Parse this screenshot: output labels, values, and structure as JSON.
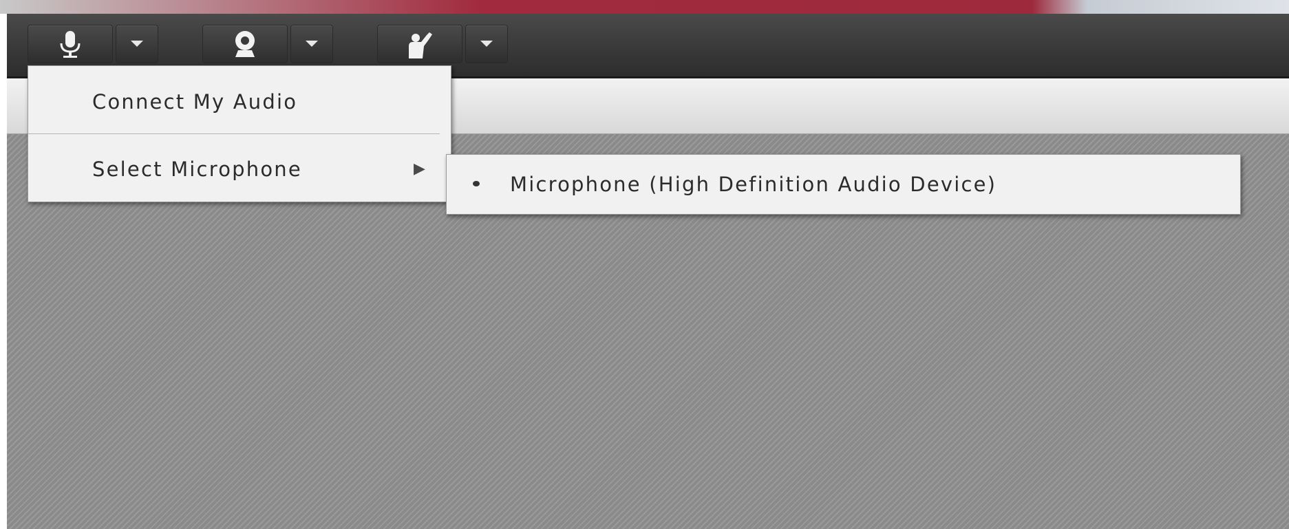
{
  "toolbar": {
    "buttons": [
      {
        "name": "microphone",
        "icon": "microphone-icon"
      },
      {
        "name": "webcam",
        "icon": "webcam-icon"
      },
      {
        "name": "raise-hand",
        "icon": "raise-hand-icon"
      }
    ]
  },
  "audio_menu": {
    "connect_label": "Connect My Audio",
    "select_mic_label": "Select Microphone",
    "submenu_arrow": "▶"
  },
  "microphone_submenu": {
    "items": [
      {
        "label": "Microphone (High Definition Audio Device)",
        "selected": true
      }
    ]
  },
  "colors": {
    "toolbar_bg": "#3a3a3a",
    "menu_bg": "#f1f1f1",
    "stage_bg": "#8e8e8e",
    "top_accent": "#a12a3e"
  }
}
